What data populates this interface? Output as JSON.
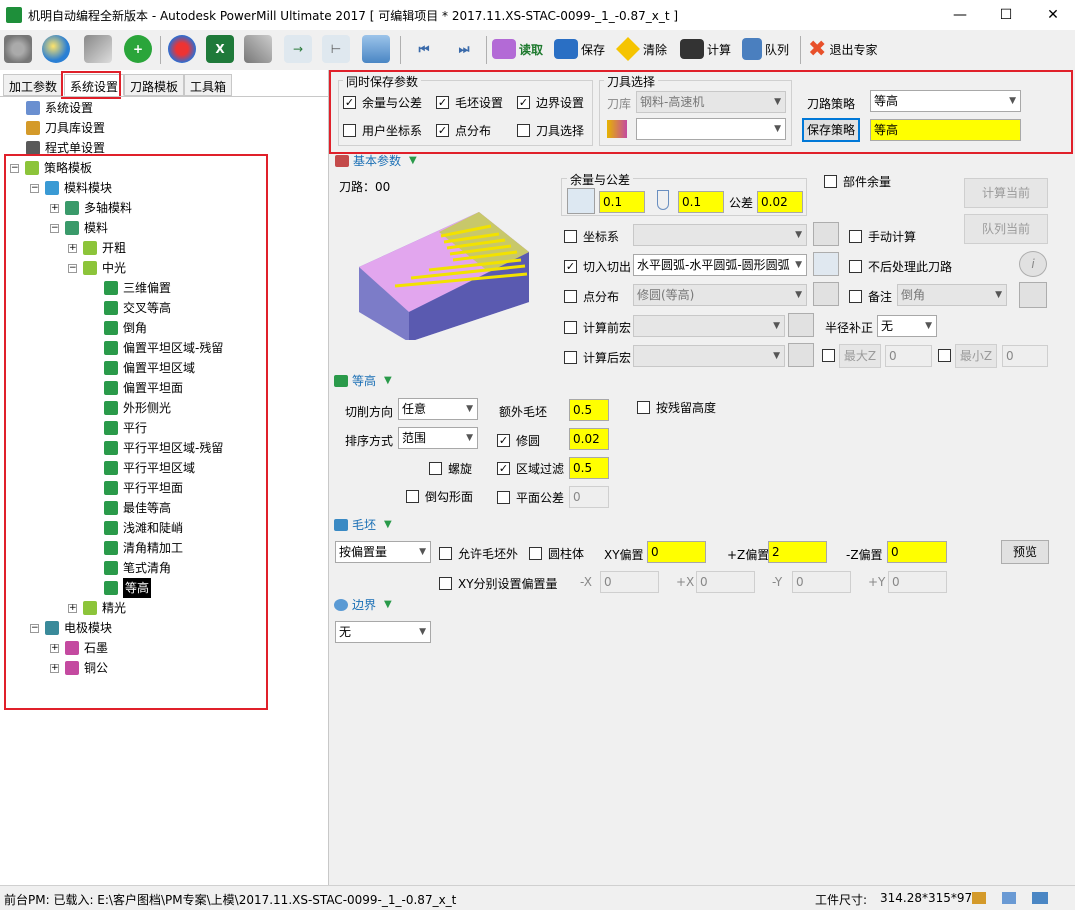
{
  "window": {
    "title": "机明自动编程全新版本 - Autodesk PowerMill Ultimate 2017    [ 可编辑项目 * 2017.11.XS-STAC-0099-_1_-0.87_x_t ]",
    "minimize": "—",
    "maximize": "☐",
    "close": "✕"
  },
  "toolbar": {
    "read": "读取",
    "save": "保存",
    "clear": "清除",
    "calc": "计算",
    "queue": "队列",
    "exit": "退出专家"
  },
  "tabs": [
    "加工参数",
    "系统设置",
    "刀路模板",
    "工具箱"
  ],
  "tree": {
    "system": "系统设置",
    "toollib": "刀具库设置",
    "program": "程式单设置",
    "strategy": "策略模板",
    "mold": "模料模块",
    "multiaxis": "多轴模料",
    "moldmat": "模料",
    "rough": "开粗",
    "semi": "中光",
    "semi_items": [
      "三维偏置",
      "交叉等高",
      "倒角",
      "偏置平坦区域-残留",
      "偏置平坦区域",
      "偏置平坦面",
      "外形侧光",
      "平行",
      "平行平坦区域-残留",
      "平行平坦区域",
      "平行平坦面",
      "最佳等高",
      "浅滩和陡峭",
      "清角精加工",
      "笔式清角",
      "等高"
    ],
    "finish": "精光",
    "electrode": "电极模块",
    "graphite": "石墨",
    "copper": "铜公"
  },
  "save_group": {
    "title": "同时保存参数",
    "items": {
      "allowance": "余量与公差",
      "blank": "毛坯设置",
      "boundary": "边界设置",
      "ucs": "用户坐标系",
      "points": "点分布",
      "tool": "刀具选择"
    }
  },
  "tool_group": {
    "title": "刀具选择",
    "lib_label": "刀库",
    "lib_value": "钢料-高速机",
    "tool_value": ""
  },
  "strategy_group": {
    "label": "刀路策略",
    "value": "等高",
    "save_button": "保存策略",
    "name_value": "等高"
  },
  "basic": {
    "header": "基本参数",
    "toolpath": "刀路：00",
    "allowance_title": "余量与公差",
    "radial": "0.1",
    "axial": "0.1",
    "tol_label": "公差",
    "tol": "0.02",
    "part_allowance": "部件余量",
    "calc_current": "计算当前",
    "queue_current": "队列当前",
    "ucs": "坐标系",
    "leadin": "切入切出",
    "leadin_value": "水平圆弧-水平圆弧-圆形圆弧",
    "points": "点分布",
    "points_value": "修圆(等高)",
    "precalc": "计算前宏",
    "postcalc": "计算后宏",
    "manual": "手动计算",
    "noprocess": "不后处理此刀路",
    "note": "备注",
    "note_value": "倒角",
    "radius_comp": "半径补正",
    "radius_value": "无",
    "maxz": "最大Z",
    "maxz_value": "0",
    "minz": "最小Z",
    "minz_value": "0"
  },
  "contour": {
    "header": "等高",
    "cut_dir": "切削方向",
    "cut_dir_value": "任意",
    "order": "排序方式",
    "order_value": "范围",
    "extra_stock": "额外毛坯",
    "extra_stock_value": "0.5",
    "round": "修圆",
    "round_value": "0.02",
    "area_filter": "区域过滤",
    "area_filter_value": "0.5",
    "flat_tol": "平面公差",
    "flat_tol_value": "0",
    "scallop": "按残留高度",
    "spiral": "螺旋",
    "fillet": "倒勾形面"
  },
  "block": {
    "header": "毛坯",
    "type_value": "按偏置量",
    "allow_outside": "允许毛坯外",
    "cylinder": "圆柱体",
    "xy_offset": "XY偏置",
    "xy_value": "0",
    "pz_offset": "+Z偏置",
    "pz_value": "2",
    "nz_offset": "-Z偏置",
    "nz_value": "0",
    "preview": "预览",
    "xy_separate": "XY分别设置偏置量",
    "mx": "-X",
    "mx_value": "0",
    "px": "+X",
    "px_value": "0",
    "my": "-Y",
    "my_value": "0",
    "py": "+Y",
    "py_value": "0"
  },
  "boundary": {
    "header": "边界",
    "value": "无"
  },
  "status": {
    "left": "前台PM: 已载入: E:\\客户图档\\PM专案\\上模\\2017.11.XS-STAC-0099-_1_-0.87_x_t",
    "size_label": "工件尺寸:",
    "size_value": "314.28*315*97"
  }
}
